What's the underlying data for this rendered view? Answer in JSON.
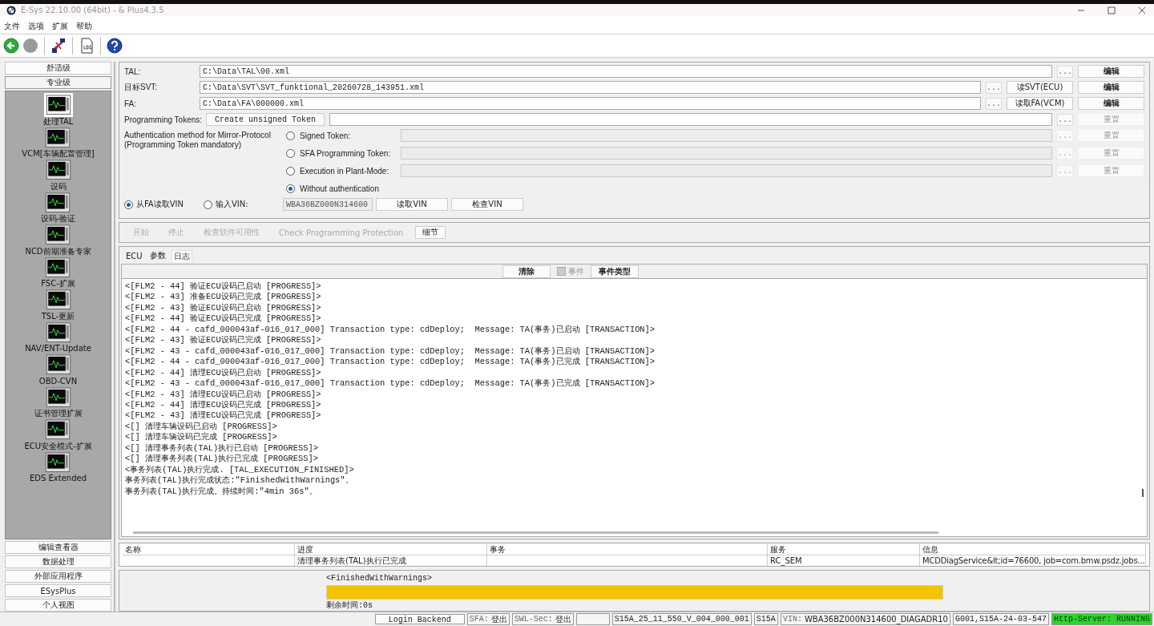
{
  "window": {
    "title": "E-Sys 22.10.00  (64bit) -  & Plus4.3.5"
  },
  "menu": [
    "文件",
    "选项",
    "扩展",
    "帮助"
  ],
  "toolbar": [
    {
      "kind": "back",
      "disabled": false
    },
    {
      "kind": "forward",
      "disabled": true
    },
    {
      "kind": "connect",
      "disabled": false
    },
    {
      "kind": "log",
      "disabled": false
    },
    {
      "kind": "help",
      "disabled": false
    }
  ],
  "sidebar": {
    "levels": [
      {
        "label": "舒适级",
        "selected": false
      },
      {
        "label": "专业级",
        "selected": true
      }
    ],
    "tools": [
      {
        "label": "处理TAL",
        "selected": true
      },
      {
        "label": "VCM[车辆配置管理]",
        "selected": false
      },
      {
        "label": "设码",
        "selected": false
      },
      {
        "label": "设码-验证",
        "selected": false
      },
      {
        "label": "NCD前期准备专家",
        "selected": false
      },
      {
        "label": "FSC-扩展",
        "selected": false
      },
      {
        "label": "TSL-更新",
        "selected": false
      },
      {
        "label": "NAV/ENT-Update",
        "selected": false
      },
      {
        "label": "OBD-CVN",
        "selected": false
      },
      {
        "label": "证书管理扩展",
        "selected": false
      },
      {
        "label": "ECU安全模式-扩展",
        "selected": false
      },
      {
        "label": "EDS Extended",
        "selected": false
      }
    ],
    "bottom": [
      "编辑查看器",
      "数据处理",
      "外部应用程序",
      "ESysPlus",
      "个人视图"
    ]
  },
  "files": [
    {
      "label": "TAL:",
      "value": "C:\\Data\\TAL\\00.xml",
      "browse": "...",
      "buttons": [
        "编辑"
      ]
    },
    {
      "label": "目标SVT:",
      "value": "C:\\Data\\SVT\\SVT_funktional_20260728_143951.xml",
      "browse": "...",
      "buttons": [
        "读SVT(ECU)",
        "编辑"
      ]
    },
    {
      "label": "FA:",
      "value": "C:\\Data\\FA\\000000.xml",
      "browse": "...",
      "buttons": [
        "读取FA(VCM)",
        "编辑"
      ]
    }
  ],
  "tokens": {
    "label": "Programming Tokens:",
    "create": "Create unsigned Token",
    "browse": "...",
    "reset": "重置",
    "reset_disabled": true
  },
  "auth": {
    "label": [
      "Authentication method for Mirror-Protocol",
      "(Programming Token mandatory)"
    ],
    "options": [
      {
        "label": "Signed Token:",
        "selected": false,
        "kind": "field",
        "browse": "...",
        "reset": "重置"
      },
      {
        "label": "SFA Programming Token:",
        "selected": false,
        "kind": "field",
        "browse": "...",
        "reset": "重置"
      },
      {
        "label": "Execution in Plant-Mode:",
        "selected": false,
        "kind": "field",
        "browse": "...",
        "reset": "重置"
      },
      {
        "label": "Without authentication",
        "selected": true,
        "kind": "plain"
      }
    ]
  },
  "vin": {
    "options": [
      {
        "label": "从FA读取VIN",
        "selected": true
      },
      {
        "label": "输入VIN:",
        "selected": false
      }
    ],
    "value": "WBA36BZ000N314600",
    "disabled": true,
    "buttons": [
      "读取VIN",
      "检查VIN"
    ]
  },
  "actions": [
    {
      "label": "开始",
      "disabled": true
    },
    {
      "label": "停止",
      "disabled": true
    },
    {
      "label": "检查软件可用性",
      "disabled": true
    },
    {
      "label": "Check Programming Protection",
      "disabled": true
    },
    {
      "label": "细节",
      "disabled": false
    }
  ],
  "tabs": [
    {
      "label": "ECU",
      "selected": false
    },
    {
      "label": "参数",
      "selected": false
    },
    {
      "label": "日志",
      "selected": true
    }
  ],
  "log_toolbar": [
    {
      "kind": "button",
      "label": "清除",
      "disabled": false
    },
    {
      "kind": "checkbox",
      "label": "事件",
      "checked": false,
      "disabled": true
    },
    {
      "kind": "button",
      "label": "事件类型",
      "disabled": false
    }
  ],
  "log": [
    "<[FLM2 - 44] 验证ECU设码已启动 [PROGRESS]>",
    "<[FLM2 - 43] 准备ECU设码已完成 [PROGRESS]>",
    "<[FLM2 - 43] 验证ECU设码已启动 [PROGRESS]>",
    "<[FLM2 - 44] 验证ECU设码已完成 [PROGRESS]>",
    "<[FLM2 - 44 - cafd_000043af-016_017_000] Transaction type: cdDeploy;  Message: TA(事务)已启动 [TRANSACTION]>",
    "<[FLM2 - 43] 验证ECU设码已完成 [PROGRESS]>",
    "<[FLM2 - 43 - cafd_000043af-016_017_000] Transaction type: cdDeploy;  Message: TA(事务)已启动 [TRANSACTION]>",
    "<[FLM2 - 44 - cafd_000043af-016_017_000] Transaction type: cdDeploy;  Message: TA(事务)已完成 [TRANSACTION]>",
    "<[FLM2 - 44] 清理ECU设码已启动 [PROGRESS]>",
    "<[FLM2 - 43 - cafd_000043af-016_017_000] Transaction type: cdDeploy;  Message: TA(事务)已完成 [TRANSACTION]>",
    "<[FLM2 - 43] 清理ECU设码已启动 [PROGRESS]>",
    "<[FLM2 - 44] 清理ECU设码已完成 [PROGRESS]>",
    "<[FLM2 - 43] 清理ECU设码已完成 [PROGRESS]>",
    "<[] 清理车辆设码已启动 [PROGRESS]>",
    "<[] 清理车辆设码已完成 [PROGRESS]>",
    "<[] 清理事务列表(TAL)执行已启动 [PROGRESS]>",
    "<[] 清理事务列表(TAL)执行已完成 [PROGRESS]>",
    "<事务列表(TAL)执行完成. [TAL_EXECUTION_FINISHED]>",
    "事务列表(TAL)执行完成状态:\"FinishedWithWarnings\"。",
    "事务列表(TAL)执行完成。持续时间:\"4min 36s\"。"
  ],
  "table": {
    "columns": [
      {
        "label": "名称"
      },
      {
        "label": "进度"
      },
      {
        "label": "事务"
      },
      {
        "label": "服务"
      },
      {
        "label": "信息"
      }
    ],
    "rows": [
      {
        "progress": "清理事务列表(TAL)执行已完成",
        "service": "RC_SEM",
        "info": "MCDDiagService&lt;id=76600, job=com.bmw.psdz.jobs..."
      }
    ]
  },
  "progress": {
    "status": "<FinishedWithWarnings>",
    "level": 1,
    "remaining": "剩余时间:0s"
  },
  "status_bar": [
    {
      "kind": "button",
      "label": "Login Backend"
    },
    {
      "kind": "pair",
      "label": "SFA:",
      "value": "登出"
    },
    {
      "kind": "pair",
      "label": "SWL-Sec:",
      "value": "登出"
    },
    {
      "kind": "blank"
    },
    {
      "kind": "text",
      "label": "S15A_25_11_550_V_004_000_001"
    },
    {
      "kind": "text",
      "label": "S15A"
    },
    {
      "kind": "pair",
      "label": "VIN:",
      "value": "WBA36BZ000N314600_DIAGADR10"
    },
    {
      "kind": "text",
      "label": "G001,S15A-24-03-547"
    },
    {
      "kind": "state",
      "label": "Http-Server: RUNNING",
      "on": true
    }
  ]
}
